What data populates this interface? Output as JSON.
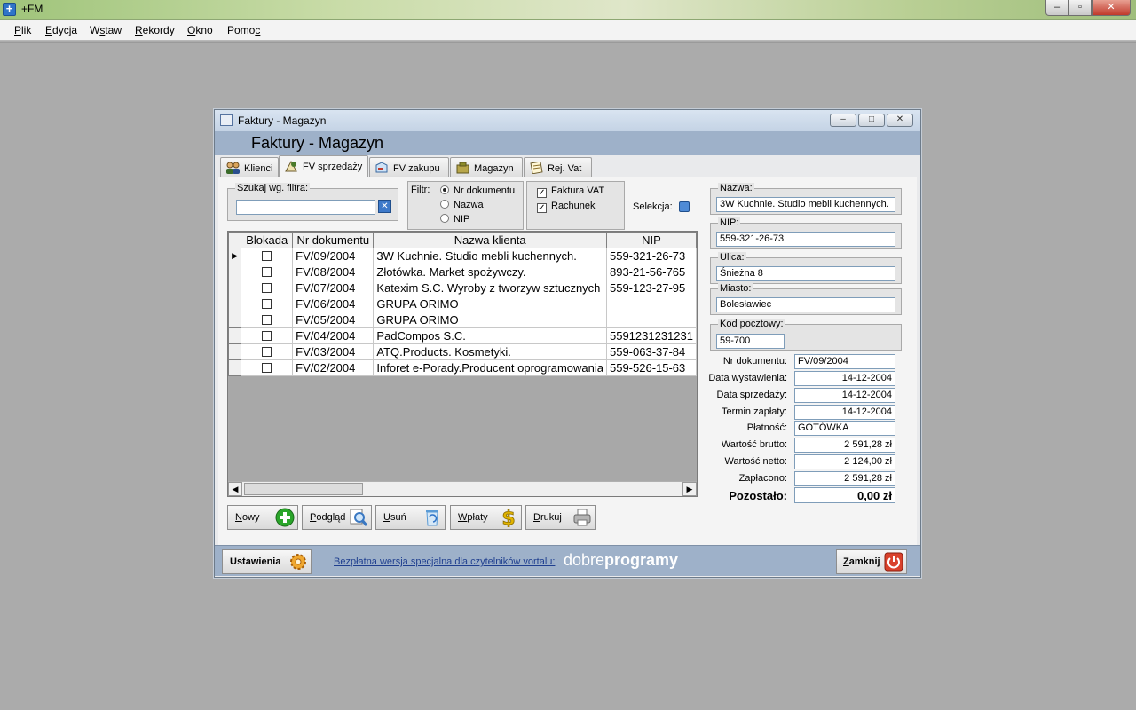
{
  "app": {
    "title": "+FM",
    "icon_glyph": "+",
    "min_glyph": "‒",
    "max_glyph": "▫",
    "close_glyph": "✕"
  },
  "menu": [
    {
      "pre": "",
      "u": "P",
      "post": "lik"
    },
    {
      "pre": "",
      "u": "E",
      "post": "dycja"
    },
    {
      "pre": "W",
      "u": "s",
      "post": "taw"
    },
    {
      "pre": "",
      "u": "R",
      "post": "ekordy"
    },
    {
      "pre": "",
      "u": "O",
      "post": "kno"
    },
    {
      "pre": "Pomo",
      "u": "c",
      "post": ""
    }
  ],
  "window": {
    "title": "Faktury - Magazyn",
    "header": "Faktury - Magazyn",
    "btn_min": "‒",
    "btn_max": "□",
    "btn_close": "✕"
  },
  "tabs": [
    {
      "label": "Klienci",
      "icon": "clients-icon",
      "color": "#6b4c1f"
    },
    {
      "label": "FV sprzedaży",
      "icon": "invoice-sale-icon",
      "color": "#4a7a2a"
    },
    {
      "label": "FV zakupu",
      "icon": "invoice-purchase-icon",
      "color": "#c0392b"
    },
    {
      "label": "Magazyn",
      "icon": "warehouse-icon",
      "color": "#7a7a1f"
    },
    {
      "label": "Rej. Vat",
      "icon": "vat-register-icon",
      "color": "#8a6d2a"
    }
  ],
  "filter": {
    "search_legend": "Szukaj wg. filtra:",
    "search_value": "",
    "clear_glyph": "✕",
    "filter_label": "Filtr:",
    "radios": [
      {
        "label": "Nr dokumentu",
        "checked": true
      },
      {
        "label": "Nazwa",
        "checked": false
      },
      {
        "label": "NIP",
        "checked": false
      }
    ],
    "checks": [
      {
        "label": "Faktura VAT",
        "checked": true
      },
      {
        "label": "Rachunek",
        "checked": true
      }
    ],
    "check_glyph": "✓",
    "selection_label": "Selekcja:"
  },
  "grid": {
    "columns": [
      "Blokada",
      "Nr dokumentu",
      "Nazwa klienta",
      "NIP"
    ],
    "current_row_marker": "▶",
    "rows": [
      {
        "nr": "FV/09/2004",
        "name": "3W Kuchnie. Studio mebli kuchennych.",
        "nip": "559-321-26-73"
      },
      {
        "nr": "FV/08/2004",
        "name": "Złotówka. Market spożywczy.",
        "nip": "893-21-56-765"
      },
      {
        "nr": "FV/07/2004",
        "name": "Katexim S.C. Wyroby z tworzyw sztucznych",
        "nip": "559-123-27-95"
      },
      {
        "nr": "FV/06/2004",
        "name": "GRUPA ORIMO",
        "nip": ""
      },
      {
        "nr": "FV/05/2004",
        "name": "GRUPA ORIMO",
        "nip": ""
      },
      {
        "nr": "FV/04/2004",
        "name": "PadCompos S.C.",
        "nip": "5591231231231"
      },
      {
        "nr": "FV/03/2004",
        "name": "ATQ.Products. Kosmetyki.",
        "nip": "559-063-37-84"
      },
      {
        "nr": "FV/02/2004",
        "name": "Inforet e-Porady.Producent oprogramowania",
        "nip": "559-526-15-63"
      }
    ],
    "scroll_left": "◀",
    "scroll_right": "▶"
  },
  "details": {
    "nazwa_label": "Nazwa:",
    "nazwa": "3W Kuchnie. Studio mebli kuchennych.",
    "nip_label": "NIP:",
    "nip": "559-321-26-73",
    "ulica_label": "Ulica:",
    "ulica": "Śnieżna 8",
    "miasto_label": "Miasto:",
    "miasto": "Bolesławiec",
    "kod_label": "Kod pocztowy:",
    "kod": "59-700",
    "fields": [
      {
        "label": "Nr dokumentu:",
        "value": "FV/09/2004",
        "align": "left"
      },
      {
        "label": "Data wystawienia:",
        "value": "14-12-2004",
        "align": "right"
      },
      {
        "label": "Data sprzedaży:",
        "value": "14-12-2004",
        "align": "right"
      },
      {
        "label": "Termin zapłaty:",
        "value": "14-12-2004",
        "align": "right"
      },
      {
        "label": "Płatność:",
        "value": "GOTÓWKA",
        "align": "left"
      },
      {
        "label": "Wartość brutto:",
        "value": "2 591,28 zł",
        "align": "right"
      },
      {
        "label": "Wartość netto:",
        "value": "2 124,00 zł",
        "align": "right"
      },
      {
        "label": "Zapłacono:",
        "value": "2 591,28 zł",
        "align": "right"
      }
    ],
    "pozostalo_label": "Pozostało:",
    "pozostalo": "0,00 zł"
  },
  "buttons": [
    {
      "pre": "",
      "u": "N",
      "post": "owy",
      "icon": "add-icon",
      "color": "#2aa52a"
    },
    {
      "pre": "",
      "u": "P",
      "post": "odgląd",
      "icon": "preview-icon",
      "color": "#3a78c2"
    },
    {
      "pre": "",
      "u": "U",
      "post": "suń",
      "icon": "delete-icon",
      "color": "#5a9bd6"
    },
    {
      "pre": "",
      "u": "W",
      "post": "płaty",
      "icon": "payments-icon",
      "color": "#e2b400"
    },
    {
      "pre": "",
      "u": "D",
      "post": "rukuj",
      "icon": "print-icon",
      "color": "#8a8a8a"
    }
  ],
  "footer": {
    "settings_label": "Ustawienia",
    "link_text": "Bezpłatna wersja specjalna dla czytelników vortalu:",
    "brand_light": "dobre",
    "brand_bold": "programy",
    "close_pre": "",
    "close_u": "Z",
    "close_post": "amknij",
    "close_color": "#d9412b"
  }
}
